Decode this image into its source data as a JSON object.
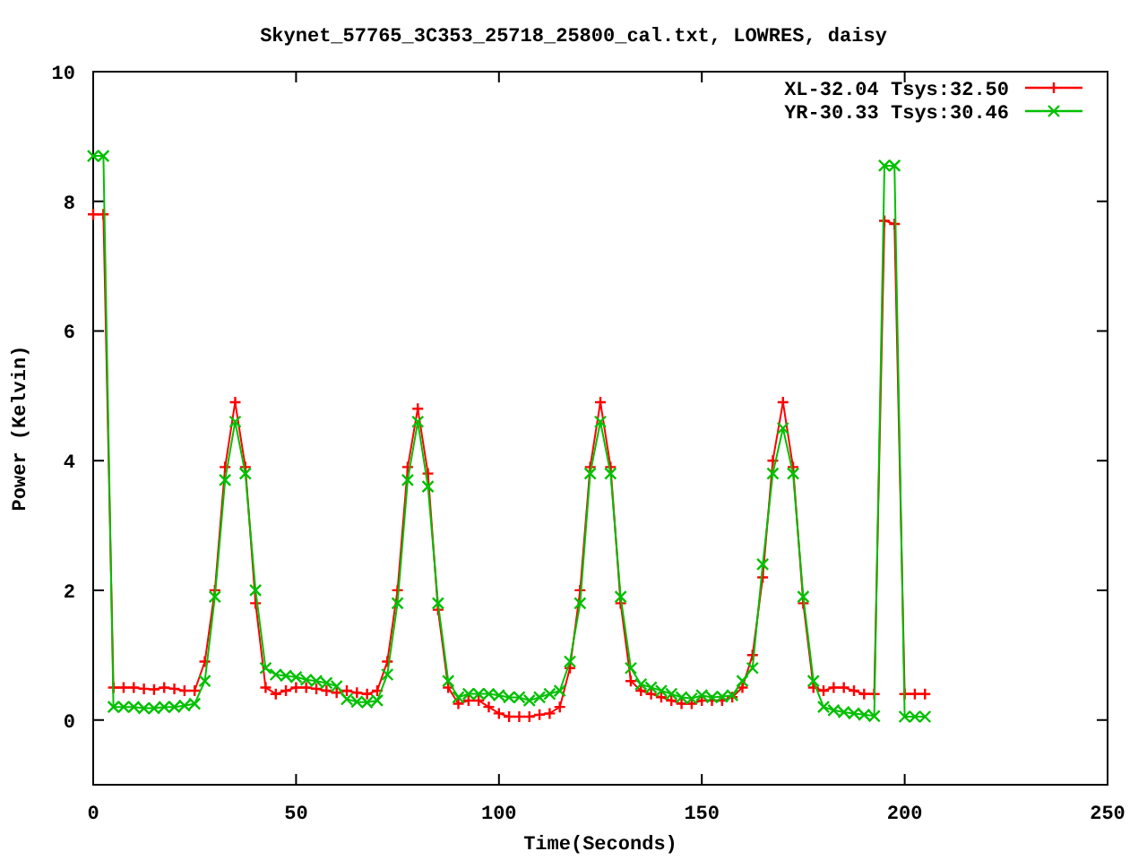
{
  "chart_data": {
    "type": "line",
    "title": "Skynet_57765_3C353_25718_25800_cal.txt, LOWRES, daisy",
    "xlabel": "Time(Seconds)",
    "ylabel": "Power (Kelvin)",
    "x": [
      0,
      2.5,
      5,
      7.5,
      10,
      12.5,
      15,
      17.5,
      20,
      22.5,
      25,
      27.5,
      30,
      32.5,
      35,
      37.5,
      40,
      42.5,
      45,
      47.5,
      50,
      52.5,
      55,
      57.5,
      60,
      62.5,
      65,
      67.5,
      70,
      72.5,
      75,
      77.5,
      80,
      82.5,
      85,
      87.5,
      90,
      92.5,
      95,
      97.5,
      100,
      102.5,
      105,
      107.5,
      110,
      112.5,
      115,
      117.5,
      120,
      122.5,
      125,
      127.5,
      130,
      132.5,
      135,
      137.5,
      140,
      142.5,
      145,
      147.5,
      150,
      152.5,
      155,
      157.5,
      160,
      162.5,
      165,
      167.5,
      170,
      172.5,
      175,
      177.5,
      180,
      182.5,
      185,
      187.5,
      190,
      192.5,
      195,
      197.5,
      200,
      202.5,
      205
    ],
    "series": [
      {
        "name": "XL-32.04 Tsys:32.50",
        "color": "#ff0000",
        "marker": "plus",
        "values": [
          7.8,
          7.8,
          0.5,
          0.5,
          0.5,
          0.48,
          0.47,
          0.5,
          0.48,
          0.45,
          0.45,
          0.9,
          2.0,
          3.9,
          4.9,
          3.9,
          1.8,
          0.5,
          0.4,
          0.45,
          0.5,
          0.5,
          0.48,
          0.45,
          0.42,
          0.45,
          0.42,
          0.4,
          0.45,
          0.9,
          2.0,
          3.9,
          4.8,
          3.8,
          1.7,
          0.5,
          0.25,
          0.3,
          0.3,
          0.2,
          0.1,
          0.05,
          0.05,
          0.05,
          0.08,
          0.1,
          0.2,
          0.8,
          2.0,
          3.9,
          4.9,
          3.9,
          1.8,
          0.6,
          0.45,
          0.4,
          0.35,
          0.3,
          0.25,
          0.25,
          0.3,
          0.3,
          0.3,
          0.35,
          0.5,
          1.0,
          2.2,
          4.0,
          4.9,
          3.9,
          1.8,
          0.5,
          0.45,
          0.5,
          0.5,
          0.45,
          0.4,
          0.4,
          7.7,
          7.65,
          0.4,
          0.4,
          0.4
        ]
      },
      {
        "name": "YR-30.33 Tsys:30.46",
        "color": "#00c000",
        "marker": "cross",
        "values": [
          8.7,
          8.7,
          0.2,
          0.2,
          0.2,
          0.18,
          0.18,
          0.2,
          0.2,
          0.22,
          0.25,
          0.6,
          1.9,
          3.7,
          4.6,
          3.8,
          2.0,
          0.8,
          0.7,
          0.68,
          0.66,
          0.62,
          0.6,
          0.57,
          0.52,
          0.32,
          0.28,
          0.27,
          0.3,
          0.7,
          1.8,
          3.7,
          4.6,
          3.6,
          1.8,
          0.6,
          0.35,
          0.4,
          0.4,
          0.4,
          0.38,
          0.35,
          0.35,
          0.3,
          0.35,
          0.4,
          0.45,
          0.9,
          1.8,
          3.8,
          4.6,
          3.8,
          1.9,
          0.8,
          0.55,
          0.5,
          0.45,
          0.4,
          0.35,
          0.33,
          0.38,
          0.35,
          0.36,
          0.38,
          0.6,
          0.8,
          2.4,
          3.8,
          4.5,
          3.8,
          1.9,
          0.6,
          0.2,
          0.15,
          0.12,
          0.1,
          0.08,
          0.06,
          8.55,
          8.55,
          0.05,
          0.05,
          0.05
        ]
      }
    ],
    "legend": true,
    "xlim": [
      0,
      250
    ],
    "ylim": [
      -1,
      10
    ],
    "xticks": [
      0,
      50,
      100,
      150,
      200,
      250
    ],
    "yticks": [
      0,
      2,
      4,
      6,
      8,
      10
    ]
  }
}
